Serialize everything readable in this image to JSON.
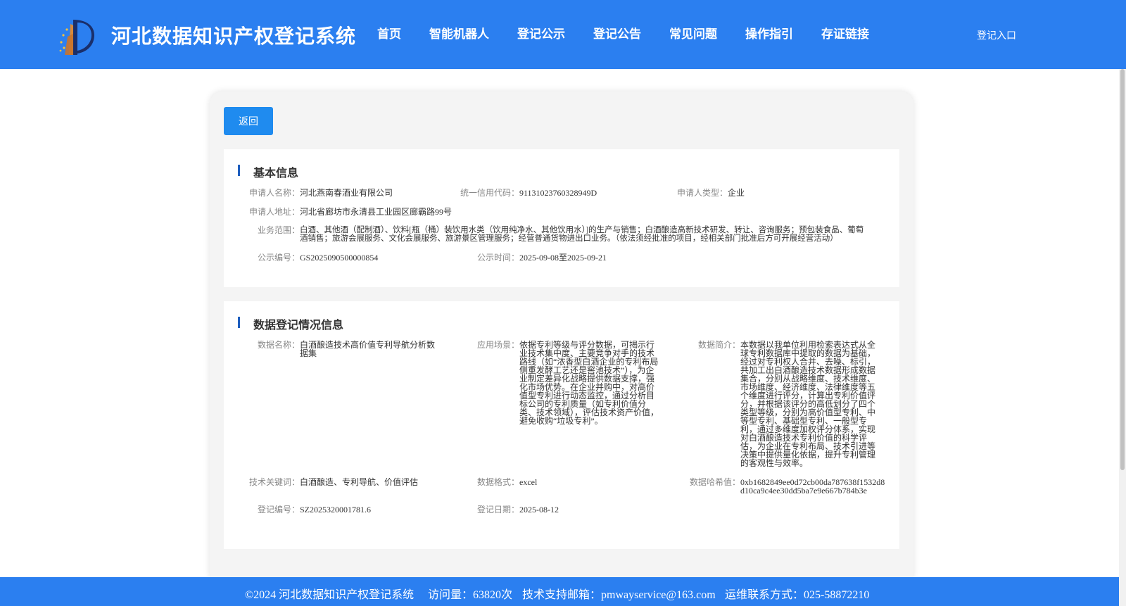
{
  "header": {
    "site_title": "河北数据知识产权登记系统",
    "nav": [
      "首页",
      "智能机器人",
      "登记公示",
      "登记公告",
      "常见问题",
      "操作指引",
      "存证链接"
    ],
    "login": "登记入口"
  },
  "back_label": "返回",
  "basic": {
    "title": "基本信息",
    "applicant_name_label": "申请人名称：",
    "applicant_name": "河北燕南春酒业有限公司",
    "credit_code_label": "统一信用代码：",
    "credit_code": "91131023760328949D",
    "applicant_type_label": "申请人类型：",
    "applicant_type": "企业",
    "address_label": "申请人地址：",
    "address": "河北省廊坊市永清县工业园区廊霸路99号",
    "scope_label": "业务范围：",
    "scope": "白酒、其他酒（配制酒）、饮料[瓶（桶）装饮用水类（饮用纯净水、其他饮用水）]的生产与销售；白酒酿造高新技术研发、转让、咨询服务；预包装食品、葡萄酒销售；旅游会展服务、文化会展服务、旅游景区管理服务；经营普通货物进出口业务。（依法须经批准的项目，经相关部门批准后方可开展经营活动）",
    "pub_no_label": "公示编号：",
    "pub_no": "GS2025090500000854",
    "pub_time_label": "公示时间：",
    "pub_time": "2025-09-08至2025-09-21"
  },
  "registration": {
    "title": "数据登记情况信息",
    "data_name_label": "数据名称：",
    "data_name": "白酒酿造技术高价值专利导航分析数据集",
    "scenario_label": "应用场景：",
    "scenario": "依据专利等级与评分数据，可揭示行业技术集中度、主要竞争对手的技术路线（如“浓香型白酒企业的专利布局侧重发酵工艺还是窖池技术”），为企业制定差异化战略提供数据支撑，强化市场优势。在企业并购中，对高价值型专利进行动态监控，通过分析目标公司的专利质量（如专利价值分类、技术领域），评估技术资产价值，避免收购“垃圾专利”。",
    "intro_label": "数据简介：",
    "intro": "本数据以我单位利用检索表达式从全球专利数据库中提取的数据为基础，经过对专利权人合并、去噪、标引，共加工出白酒酿造技术数据形成数据集合，分别从战略维度、技术维度、市场维度、经济维度、法律维度等五个维度进行评分，计算出专利价值评分，并根据该评分的高低划分了四个类型等级，分别为高价值型专利、中等型专利、基础型专利、一般型专利，通过多维度加权评分体系，实现对白酒酿造技术专利价值的科学评估，为企业在专利布局、技术引进等决策中提供量化依据，提升专利管理的客观性与效率。",
    "keywords_label": "技术关键词：",
    "keywords": "白酒酿造、专利导航、价值评估",
    "format_label": "数据格式：",
    "format": "excel",
    "hash_label": "数据哈希值：",
    "hash": "0xb1682849ee0d72cb00da787638f1532d8d10ca9c4ee30dd5ba7e9e667b784b3e",
    "reg_no_label": "登记编号：",
    "reg_no": "SZ2025320001781.6",
    "reg_date_label": "登记日期：",
    "reg_date": "2025-08-12"
  },
  "footer": {
    "copyright": "©2024 河北数据知识产权登记系统",
    "visits": "访问量：63820次",
    "email": "技术支持邮箱：pmwayservice@163.com",
    "phone": "运维联系方式：025-58872210"
  },
  "colors": {
    "header": "#2b7ff0",
    "button": "#1f8bef",
    "accent_bar": "#1f5fbf"
  }
}
